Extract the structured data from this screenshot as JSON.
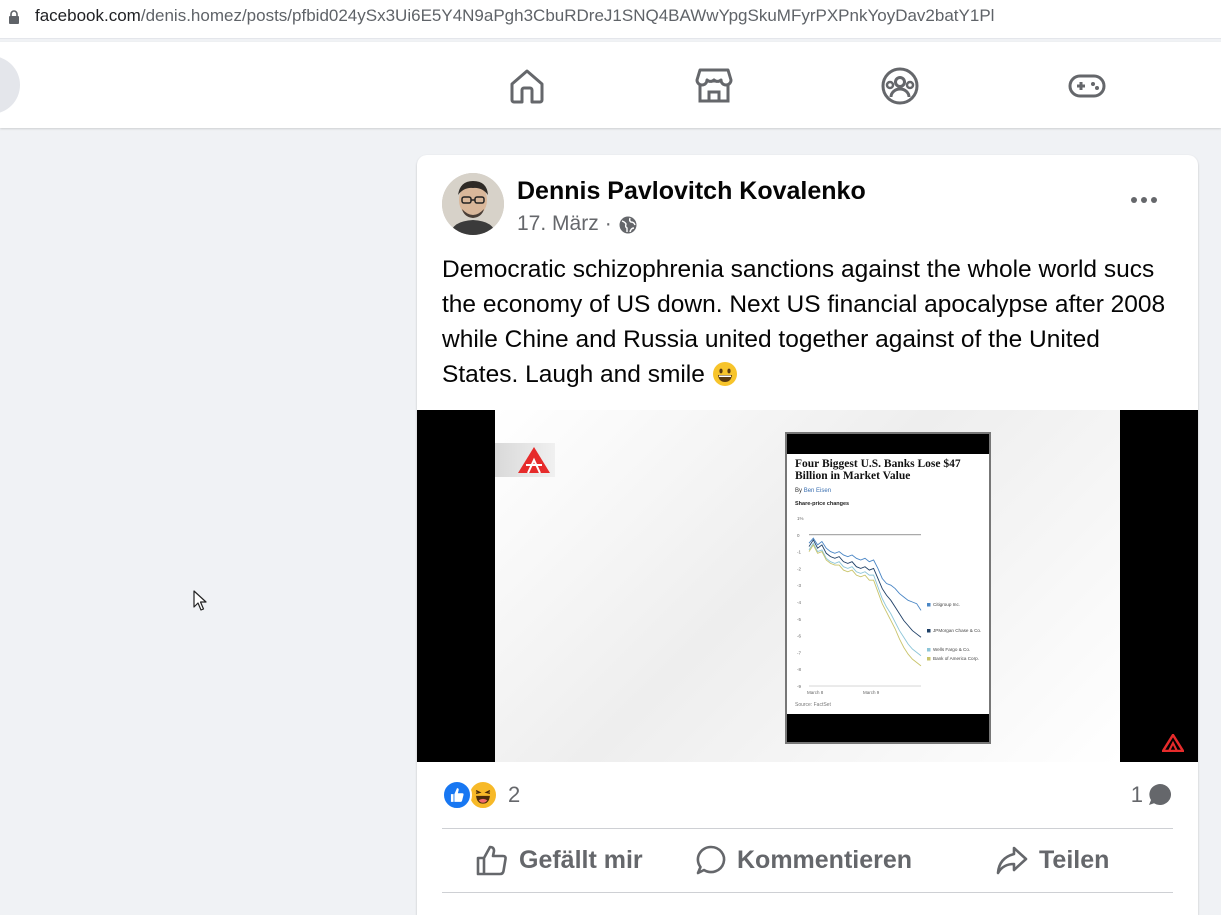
{
  "browser": {
    "url_host": "facebook.com",
    "url_path": "/denis.homez/posts/pfbid024ySx3Ui6E5Y4N9aPgh3CbuRDreJ1SNQ4BAWwYpgSkuMFyrPXPnkYoyDav2batY1Pl"
  },
  "nav": {
    "items": [
      {
        "name": "home-icon"
      },
      {
        "name": "marketplace-icon"
      },
      {
        "name": "groups-icon"
      },
      {
        "name": "gaming-icon"
      }
    ]
  },
  "post": {
    "author": "Dennis Pavlovitch Kovalenko",
    "date": "17. März",
    "separator": "·",
    "text": "Democratic schizophrenia sanctions against the whole world sucs the economy of US down.  Next US financial apocalypse after 2008 while Chine and Russia united together against of the United States. Laugh and smile",
    "media": {
      "article_title": "Four Biggest U.S. Banks Lose $47 Billion in Market Value",
      "article_byline_prefix": "By",
      "article_byline_author": "Ben Eisen",
      "article_subtitle": "Share-price changes",
      "chart_data": {
        "type": "line",
        "title": "",
        "x_ticks": [
          "March 8",
          "March 9"
        ],
        "y_ticks": [
          "1%",
          "0",
          "-1",
          "-2",
          "-3",
          "-4",
          "-5",
          "-6",
          "-7",
          "-8",
          "-9"
        ],
        "ylim": [
          -9,
          1
        ],
        "x": [
          0,
          1,
          2,
          3,
          4,
          5,
          6,
          7,
          8,
          9,
          10,
          11,
          12,
          13,
          14,
          15,
          16,
          17,
          18,
          19,
          20,
          21,
          22,
          23,
          24,
          25,
          26
        ],
        "series": [
          {
            "name": "Citigroup Inc.",
            "color": "#4a86c5",
            "values": [
              -0.5,
              -0.2,
              -0.6,
              -0.4,
              -0.8,
              -1.0,
              -1.1,
              -1.0,
              -1.2,
              -1.3,
              -1.2,
              -1.4,
              -1.5,
              -1.4,
              -1.6,
              -1.5,
              -2.0,
              -2.6,
              -2.9,
              -3.0,
              -3.2,
              -3.5,
              -3.7,
              -3.9,
              -4.0,
              -4.1,
              -4.5
            ]
          },
          {
            "name": "JPMorgan Chase & Co.",
            "color": "#1e3f66",
            "values": [
              -0.7,
              -0.3,
              -0.8,
              -0.6,
              -1.1,
              -1.3,
              -1.4,
              -1.3,
              -1.6,
              -1.7,
              -1.6,
              -1.9,
              -2.0,
              -1.9,
              -2.1,
              -2.0,
              -2.6,
              -3.2,
              -3.6,
              -3.9,
              -4.3,
              -4.7,
              -5.1,
              -5.4,
              -5.7,
              -5.9,
              -6.1
            ]
          },
          {
            "name": "Wells Fargo & Co.",
            "color": "#8cc5d8",
            "values": [
              -0.9,
              -0.5,
              -1.0,
              -0.9,
              -1.4,
              -1.6,
              -1.7,
              -1.6,
              -1.9,
              -2.0,
              -1.9,
              -2.2,
              -2.3,
              -2.2,
              -2.4,
              -2.4,
              -3.1,
              -3.8,
              -4.3,
              -4.7,
              -5.2,
              -5.7,
              -6.1,
              -6.5,
              -6.8,
              -7.0,
              -7.2
            ]
          },
          {
            "name": "Bank of America Corp.",
            "color": "#c9c46a",
            "values": [
              -1.0,
              -0.6,
              -1.1,
              -1.0,
              -1.5,
              -1.7,
              -1.8,
              -1.8,
              -2.1,
              -2.2,
              -2.1,
              -2.4,
              -2.5,
              -2.4,
              -2.7,
              -2.7,
              -3.4,
              -4.1,
              -4.6,
              -5.1,
              -5.6,
              -6.2,
              -6.7,
              -7.1,
              -7.4,
              -7.6,
              -7.8
            ]
          }
        ],
        "legend_placement": "right"
      },
      "article_source": "Source: FactSet"
    },
    "reactions": {
      "types": [
        "like-icon",
        "haha-icon"
      ],
      "count": "2"
    },
    "comment_count": "1",
    "actions": {
      "like_label": "Gefällt mir",
      "comment_label": "Kommentieren",
      "share_label": "Teilen"
    }
  },
  "colors": {
    "background": "#f0f2f5",
    "card": "#ffffff",
    "accent": "#1877f2",
    "secondary_text": "#65676b"
  }
}
